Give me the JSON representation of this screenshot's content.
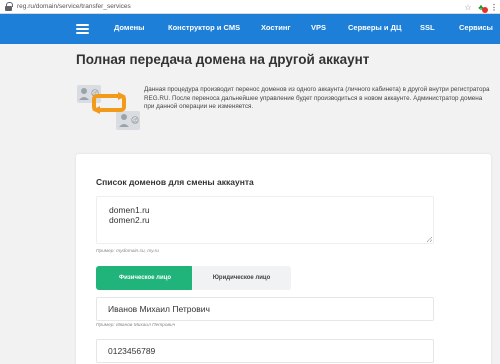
{
  "browser": {
    "url": "reg.ru/domain/service/transfer_services",
    "icons": [
      "lock-icon",
      "star-icon",
      "extension-icon",
      "menu-dots-icon"
    ]
  },
  "nav": {
    "items": [
      "Домены",
      "Конструктор и CMS",
      "Хостинг",
      "VPS",
      "Серверы и ДЦ",
      "SSL",
      "Сервисы"
    ],
    "background": "#1d7fd8"
  },
  "page": {
    "title": "Полная передача домена на другой аккаунт",
    "description": "Данная процедура производит перенос доменов из одного аккаунта (личного кабинета) в другой внутри регистратора REG.RU. После переноса дальнейшее управление будет производиться в новом аккаунте. Администратор домена при данной операции не изменяется."
  },
  "form": {
    "section_title": "Список доменов для смены аккаунта",
    "domains": [
      "domen1.ru",
      "domen2.ru"
    ],
    "domains_hint": "Пример: mydomain.su, my.ru",
    "tabs": {
      "individual": "Физическое лицо",
      "legal": "Юридическое лицо",
      "active": "individual"
    },
    "name_value": "Иванов Михаил Петрович",
    "name_hint": "Пример: Иванов Михаил Петрович",
    "account_value": "0123456789",
    "accent": "#20b47a"
  }
}
